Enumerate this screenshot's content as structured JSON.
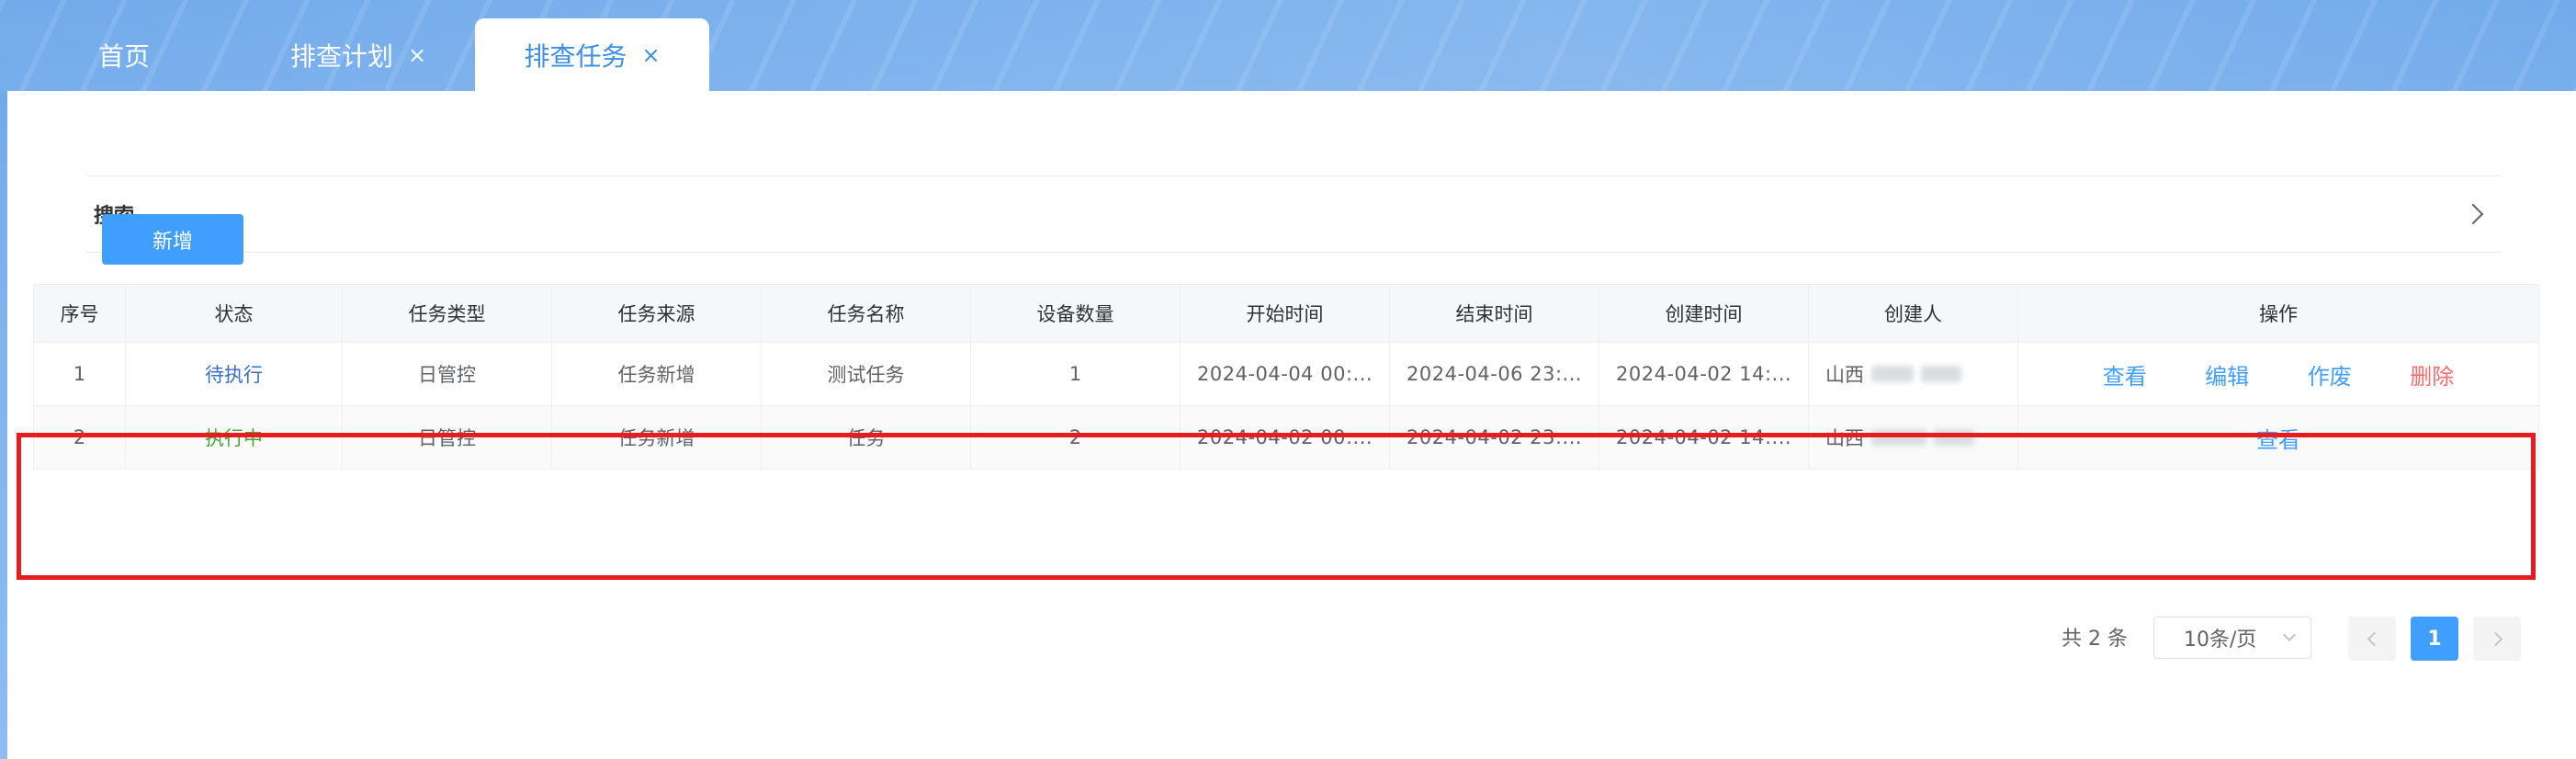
{
  "tabs": [
    {
      "label": "首页",
      "closable": false,
      "active": false
    },
    {
      "label": "排查计划",
      "closable": true,
      "active": false
    },
    {
      "label": "排查任务",
      "closable": true,
      "active": true
    }
  ],
  "tab_close_glyph": "×",
  "search": {
    "label": "搜索"
  },
  "toolbar": {
    "add_label": "新增"
  },
  "table": {
    "columns": [
      "序号",
      "状态",
      "任务类型",
      "任务来源",
      "任务名称",
      "设备数量",
      "开始时间",
      "结束时间",
      "创建时间",
      "创建人",
      "操作"
    ],
    "rows": [
      {
        "index": "1",
        "status": "待执行",
        "task_type": "日管控",
        "task_source": "任务新增",
        "task_name": "测试任务",
        "device_count": "1",
        "start_time": "2024-04-04 00:...",
        "end_time": "2024-04-06 23:...",
        "created_time": "2024-04-02 14:...",
        "creator": "山西",
        "actions": [
          "查看",
          "编辑",
          "作废",
          "删除"
        ]
      },
      {
        "index": "2",
        "status": "执行中",
        "task_type": "日管控",
        "task_source": "任务新增",
        "task_name": "任务",
        "device_count": "2",
        "start_time": "2024-04-02 00:...",
        "end_time": "2024-04-02 23:...",
        "created_time": "2024-04-02 14:...",
        "creator": "山西",
        "actions": [
          "查看"
        ]
      }
    ]
  },
  "pagination": {
    "total_text": "共 2 条",
    "page_size": "10条/页",
    "current_page": "1"
  },
  "colors": {
    "primary": "#409eff",
    "danger": "#f56c6c",
    "status_pending": "#3a6fc4",
    "status_running": "#4aa63a",
    "highlight": "#e81c1c"
  }
}
